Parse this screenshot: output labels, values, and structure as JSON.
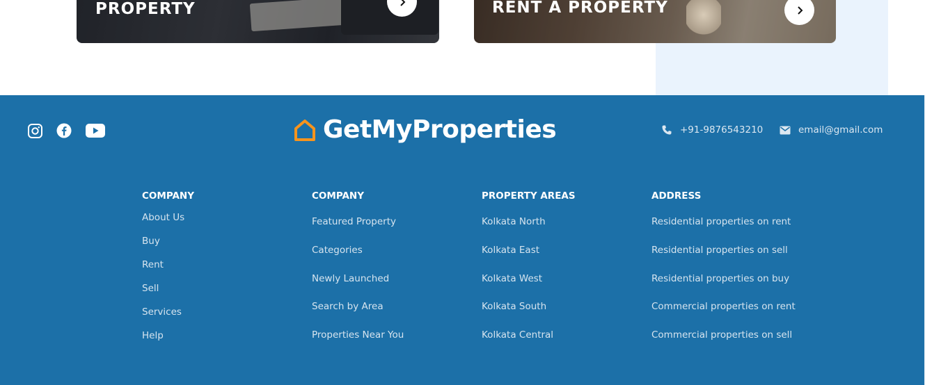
{
  "promo_cards": {
    "buy_title": "PROPERTY",
    "rent_title": "RENT A PROPERTY"
  },
  "footer": {
    "social_icons": [
      "instagram-icon",
      "facebook-icon",
      "youtube-icon"
    ],
    "brand": "GetMyProperties",
    "phone": "+91-9876543210",
    "email": "email@gmail.com",
    "columns": [
      {
        "heading": "COMPANY",
        "links": [
          "About Us",
          "Buy",
          "Rent",
          "Sell",
          "Services",
          "Help"
        ]
      },
      {
        "heading": "COMPANY",
        "links": [
          "Featured Property",
          "Categories",
          "Newly Launched",
          "Search by Area",
          "Properties Near You"
        ]
      },
      {
        "heading": "PROPERTY AREAS",
        "links": [
          "Kolkata North",
          "Kolkata East",
          "Kolkata West",
          "Kolkata South",
          "Kolkata Central"
        ]
      },
      {
        "heading": "ADDRESS",
        "links": [
          "Residential properties on rent",
          "Residential properties on sell",
          "Residential properties on buy",
          "Commercial properties on rent",
          "Commercial properties on sell"
        ]
      }
    ]
  },
  "colors": {
    "footer_bg": "#1c70a8",
    "logo_accent": "#f7941d",
    "light_panel": "#eaf3fd"
  }
}
